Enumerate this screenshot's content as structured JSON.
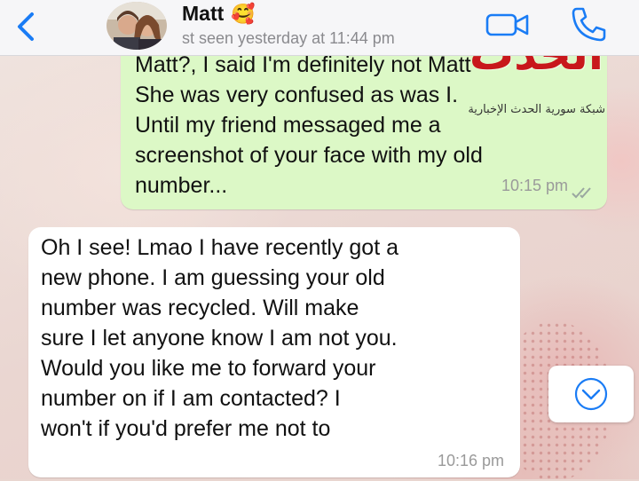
{
  "header": {
    "back_icon": "chevron-left-icon",
    "contact_name": "Matt",
    "contact_emoji": "🥰",
    "last_seen": "st seen yesterday at 11:44 pm",
    "video_icon": "video-camera-icon",
    "phone_icon": "phone-icon",
    "accent_color": "#1a7cf5"
  },
  "messages": [
    {
      "direction": "outgoing",
      "lines": [
        "Matt?, I said I'm definitely not Matt",
        "She was very confused as was I.",
        "Until my friend messaged me a",
        "screenshot of your face with my old",
        "number..."
      ],
      "time": "10:15 pm",
      "status_icon": "double-check-icon",
      "bubble_color": "#dcf8c6"
    },
    {
      "direction": "incoming",
      "lines": [
        "Oh I see! Lmao I have recently got a",
        "new phone. I am guessing your old",
        "number was recycled. Will make",
        "sure I let anyone know I am not you.",
        "Would you like me to forward your",
        "number on if I am contacted? I",
        "won't if you'd prefer me not to"
      ],
      "time": "10:16 pm",
      "bubble_color": "#ffffff"
    }
  ],
  "watermark": {
    "logo_text": "الحدث",
    "subtitle": "شبكة سورية الحدث الإخبارية",
    "color": "#c8171b"
  },
  "scroll_button": {
    "icon": "chevron-down-circle-icon"
  }
}
